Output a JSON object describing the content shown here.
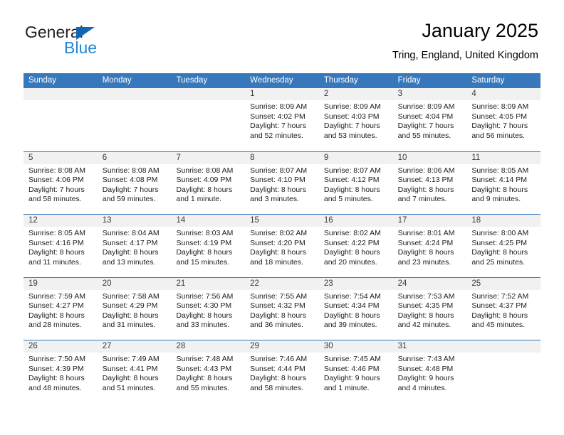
{
  "brand": {
    "name_top": "General",
    "name_bottom": "Blue",
    "triangle_color": "#1267b2",
    "blue_text_color": "#1f86d8"
  },
  "header": {
    "title": "January 2025",
    "subtitle": "Tring, England, United Kingdom"
  },
  "theme": {
    "header_band": "#3778bc",
    "day_number_band": "#f1f1f1",
    "cell_background": "#ffffff",
    "text": "#000000"
  },
  "weekdays": [
    "Sunday",
    "Monday",
    "Tuesday",
    "Wednesday",
    "Thursday",
    "Friday",
    "Saturday"
  ],
  "weeks": [
    [
      {
        "day": "",
        "sunrise": "",
        "sunset": "",
        "daylight_1": "",
        "daylight_2": ""
      },
      {
        "day": "",
        "sunrise": "",
        "sunset": "",
        "daylight_1": "",
        "daylight_2": ""
      },
      {
        "day": "",
        "sunrise": "",
        "sunset": "",
        "daylight_1": "",
        "daylight_2": ""
      },
      {
        "day": "1",
        "sunrise": "Sunrise: 8:09 AM",
        "sunset": "Sunset: 4:02 PM",
        "daylight_1": "Daylight: 7 hours",
        "daylight_2": "and 52 minutes."
      },
      {
        "day": "2",
        "sunrise": "Sunrise: 8:09 AM",
        "sunset": "Sunset: 4:03 PM",
        "daylight_1": "Daylight: 7 hours",
        "daylight_2": "and 53 minutes."
      },
      {
        "day": "3",
        "sunrise": "Sunrise: 8:09 AM",
        "sunset": "Sunset: 4:04 PM",
        "daylight_1": "Daylight: 7 hours",
        "daylight_2": "and 55 minutes."
      },
      {
        "day": "4",
        "sunrise": "Sunrise: 8:09 AM",
        "sunset": "Sunset: 4:05 PM",
        "daylight_1": "Daylight: 7 hours",
        "daylight_2": "and 56 minutes."
      }
    ],
    [
      {
        "day": "5",
        "sunrise": "Sunrise: 8:08 AM",
        "sunset": "Sunset: 4:06 PM",
        "daylight_1": "Daylight: 7 hours",
        "daylight_2": "and 58 minutes."
      },
      {
        "day": "6",
        "sunrise": "Sunrise: 8:08 AM",
        "sunset": "Sunset: 4:08 PM",
        "daylight_1": "Daylight: 7 hours",
        "daylight_2": "and 59 minutes."
      },
      {
        "day": "7",
        "sunrise": "Sunrise: 8:08 AM",
        "sunset": "Sunset: 4:09 PM",
        "daylight_1": "Daylight: 8 hours",
        "daylight_2": "and 1 minute."
      },
      {
        "day": "8",
        "sunrise": "Sunrise: 8:07 AM",
        "sunset": "Sunset: 4:10 PM",
        "daylight_1": "Daylight: 8 hours",
        "daylight_2": "and 3 minutes."
      },
      {
        "day": "9",
        "sunrise": "Sunrise: 8:07 AM",
        "sunset": "Sunset: 4:12 PM",
        "daylight_1": "Daylight: 8 hours",
        "daylight_2": "and 5 minutes."
      },
      {
        "day": "10",
        "sunrise": "Sunrise: 8:06 AM",
        "sunset": "Sunset: 4:13 PM",
        "daylight_1": "Daylight: 8 hours",
        "daylight_2": "and 7 minutes."
      },
      {
        "day": "11",
        "sunrise": "Sunrise: 8:05 AM",
        "sunset": "Sunset: 4:14 PM",
        "daylight_1": "Daylight: 8 hours",
        "daylight_2": "and 9 minutes."
      }
    ],
    [
      {
        "day": "12",
        "sunrise": "Sunrise: 8:05 AM",
        "sunset": "Sunset: 4:16 PM",
        "daylight_1": "Daylight: 8 hours",
        "daylight_2": "and 11 minutes."
      },
      {
        "day": "13",
        "sunrise": "Sunrise: 8:04 AM",
        "sunset": "Sunset: 4:17 PM",
        "daylight_1": "Daylight: 8 hours",
        "daylight_2": "and 13 minutes."
      },
      {
        "day": "14",
        "sunrise": "Sunrise: 8:03 AM",
        "sunset": "Sunset: 4:19 PM",
        "daylight_1": "Daylight: 8 hours",
        "daylight_2": "and 15 minutes."
      },
      {
        "day": "15",
        "sunrise": "Sunrise: 8:02 AM",
        "sunset": "Sunset: 4:20 PM",
        "daylight_1": "Daylight: 8 hours",
        "daylight_2": "and 18 minutes."
      },
      {
        "day": "16",
        "sunrise": "Sunrise: 8:02 AM",
        "sunset": "Sunset: 4:22 PM",
        "daylight_1": "Daylight: 8 hours",
        "daylight_2": "and 20 minutes."
      },
      {
        "day": "17",
        "sunrise": "Sunrise: 8:01 AM",
        "sunset": "Sunset: 4:24 PM",
        "daylight_1": "Daylight: 8 hours",
        "daylight_2": "and 23 minutes."
      },
      {
        "day": "18",
        "sunrise": "Sunrise: 8:00 AM",
        "sunset": "Sunset: 4:25 PM",
        "daylight_1": "Daylight: 8 hours",
        "daylight_2": "and 25 minutes."
      }
    ],
    [
      {
        "day": "19",
        "sunrise": "Sunrise: 7:59 AM",
        "sunset": "Sunset: 4:27 PM",
        "daylight_1": "Daylight: 8 hours",
        "daylight_2": "and 28 minutes."
      },
      {
        "day": "20",
        "sunrise": "Sunrise: 7:58 AM",
        "sunset": "Sunset: 4:29 PM",
        "daylight_1": "Daylight: 8 hours",
        "daylight_2": "and 31 minutes."
      },
      {
        "day": "21",
        "sunrise": "Sunrise: 7:56 AM",
        "sunset": "Sunset: 4:30 PM",
        "daylight_1": "Daylight: 8 hours",
        "daylight_2": "and 33 minutes."
      },
      {
        "day": "22",
        "sunrise": "Sunrise: 7:55 AM",
        "sunset": "Sunset: 4:32 PM",
        "daylight_1": "Daylight: 8 hours",
        "daylight_2": "and 36 minutes."
      },
      {
        "day": "23",
        "sunrise": "Sunrise: 7:54 AM",
        "sunset": "Sunset: 4:34 PM",
        "daylight_1": "Daylight: 8 hours",
        "daylight_2": "and 39 minutes."
      },
      {
        "day": "24",
        "sunrise": "Sunrise: 7:53 AM",
        "sunset": "Sunset: 4:35 PM",
        "daylight_1": "Daylight: 8 hours",
        "daylight_2": "and 42 minutes."
      },
      {
        "day": "25",
        "sunrise": "Sunrise: 7:52 AM",
        "sunset": "Sunset: 4:37 PM",
        "daylight_1": "Daylight: 8 hours",
        "daylight_2": "and 45 minutes."
      }
    ],
    [
      {
        "day": "26",
        "sunrise": "Sunrise: 7:50 AM",
        "sunset": "Sunset: 4:39 PM",
        "daylight_1": "Daylight: 8 hours",
        "daylight_2": "and 48 minutes."
      },
      {
        "day": "27",
        "sunrise": "Sunrise: 7:49 AM",
        "sunset": "Sunset: 4:41 PM",
        "daylight_1": "Daylight: 8 hours",
        "daylight_2": "and 51 minutes."
      },
      {
        "day": "28",
        "sunrise": "Sunrise: 7:48 AM",
        "sunset": "Sunset: 4:43 PM",
        "daylight_1": "Daylight: 8 hours",
        "daylight_2": "and 55 minutes."
      },
      {
        "day": "29",
        "sunrise": "Sunrise: 7:46 AM",
        "sunset": "Sunset: 4:44 PM",
        "daylight_1": "Daylight: 8 hours",
        "daylight_2": "and 58 minutes."
      },
      {
        "day": "30",
        "sunrise": "Sunrise: 7:45 AM",
        "sunset": "Sunset: 4:46 PM",
        "daylight_1": "Daylight: 9 hours",
        "daylight_2": "and 1 minute."
      },
      {
        "day": "31",
        "sunrise": "Sunrise: 7:43 AM",
        "sunset": "Sunset: 4:48 PM",
        "daylight_1": "Daylight: 9 hours",
        "daylight_2": "and 4 minutes."
      },
      {
        "day": "",
        "sunrise": "",
        "sunset": "",
        "daylight_1": "",
        "daylight_2": ""
      }
    ]
  ]
}
